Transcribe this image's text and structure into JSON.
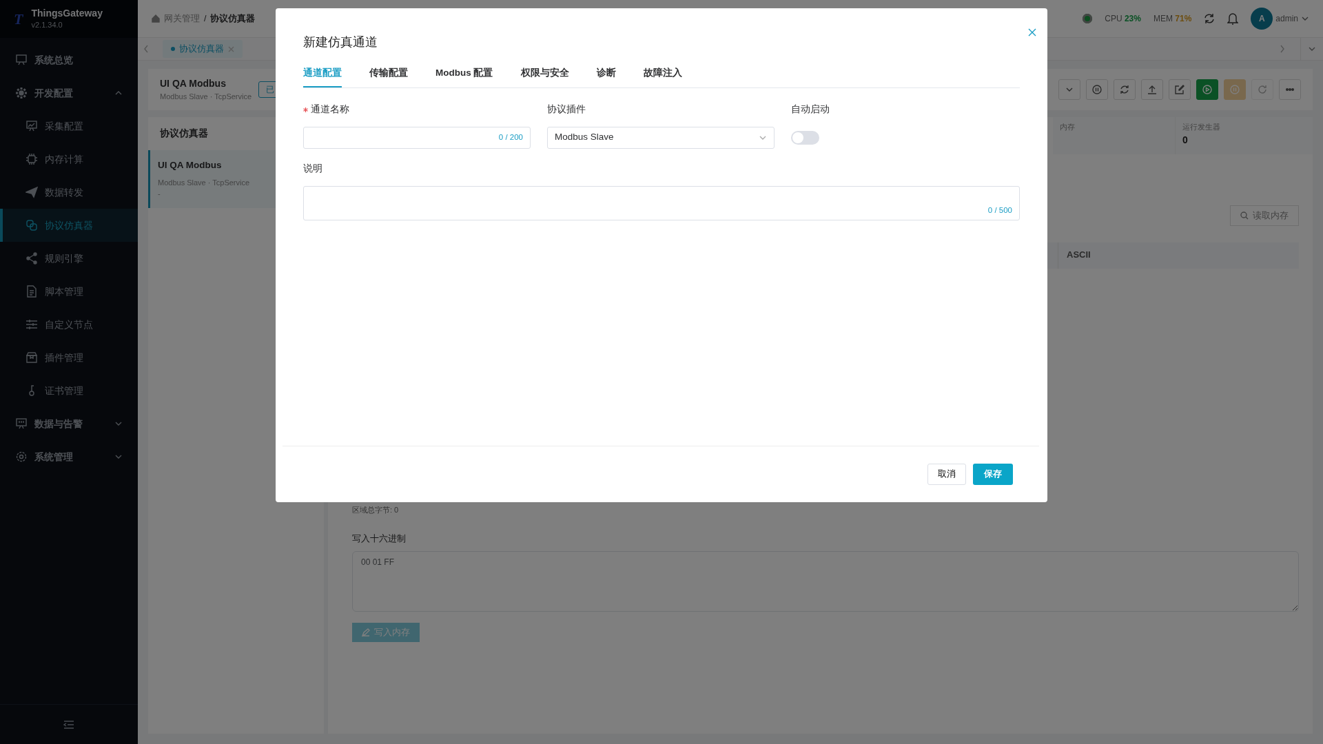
{
  "sidebar": {
    "logo": "T",
    "brand": "ThingsGateway",
    "version": "v2.1.34.0",
    "items": [
      {
        "kind": "link",
        "label": "系统总览",
        "selected": false
      },
      {
        "kind": "group",
        "label": "开发配置",
        "expanded": true,
        "children": [
          {
            "label": "采集配置",
            "selected": false
          },
          {
            "label": "内存计算",
            "selected": false
          },
          {
            "label": "数据转发",
            "selected": false
          },
          {
            "label": "协议仿真器",
            "selected": true
          },
          {
            "label": "规则引擎",
            "selected": false
          },
          {
            "label": "脚本管理",
            "selected": false
          },
          {
            "label": "自定义节点",
            "selected": false
          },
          {
            "label": "插件管理",
            "selected": false
          },
          {
            "label": "证书管理",
            "selected": false
          }
        ]
      },
      {
        "kind": "group",
        "label": "数据与告警",
        "expanded": false
      },
      {
        "kind": "group",
        "label": "系统管理",
        "expanded": false
      }
    ]
  },
  "header": {
    "breadcrumb": [
      "网关管理",
      "协议仿真器"
    ],
    "breadcrumb_separator": "/",
    "cpu_label": "CPU",
    "cpu_value": "23%",
    "mem_label": "MEM",
    "mem_value": "71%",
    "avatar": "A",
    "user": "admin"
  },
  "tabs": [
    {
      "label": "协议仿真器",
      "selected": true
    }
  ],
  "channel_bar": {
    "title": "UI QA Modbus",
    "subtitle": "Modbus Slave · TcpService",
    "status": "已",
    "toolbar": [
      {
        "kind": "default",
        "disabled": false
      },
      {
        "kind": "default",
        "disabled": false
      },
      {
        "kind": "default",
        "disabled": false
      },
      {
        "kind": "default",
        "disabled": false
      },
      {
        "kind": "default",
        "disabled": false
      },
      {
        "kind": "success",
        "disabled": false
      },
      {
        "kind": "warning",
        "disabled": true
      },
      {
        "kind": "default",
        "disabled": true
      },
      {
        "kind": "default",
        "disabled": false
      }
    ]
  },
  "channel_list": {
    "title": "协议仿真器",
    "items": [
      {
        "name": "UI QA Modbus",
        "subtitle": "Modbus Slave · TcpService",
        "note": "-",
        "selected": true
      }
    ]
  },
  "stats": [
    {
      "label": "内存"
    },
    {
      "label": "运行发生器",
      "value": "0"
    }
  ],
  "memory": {
    "read_button": "读取内存",
    "columns": [
      "ASCII"
    ],
    "total": "区域总字节: 0",
    "write_label": "写入十六进制",
    "write_placeholder": "00 01 FF",
    "write_button": {
      "label": "写入内存",
      "disabled": true
    }
  },
  "modal": {
    "title": "新建仿真通道",
    "tabs": [
      {
        "label": "通道配置",
        "selected": true
      },
      {
        "label": "传输配置",
        "selected": false
      },
      {
        "label": "Modbus 配置",
        "selected": false
      },
      {
        "label": "权限与安全",
        "selected": false
      },
      {
        "label": "诊断",
        "selected": false
      },
      {
        "label": "故障注入",
        "selected": false
      }
    ],
    "name_field": {
      "label": "通道名称",
      "required": true,
      "counter": "0 / 200"
    },
    "plugin_field": {
      "label": "协议插件",
      "value": "Modbus Slave"
    },
    "auto_start": {
      "label": "自动启动",
      "on": false
    },
    "description": {
      "label": "说明",
      "counter": "0 / 500"
    },
    "buttons": {
      "cancel": "取消",
      "save": "保存"
    }
  }
}
